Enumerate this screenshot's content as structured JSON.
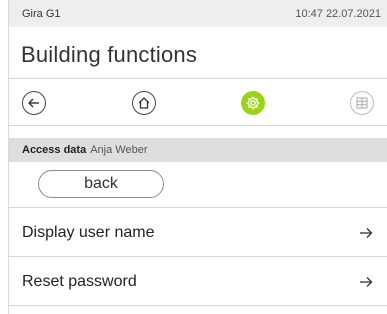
{
  "status_bar": {
    "device_name": "Gira G1",
    "datetime": "10:47 22.07.2021"
  },
  "header": {
    "title": "Building functions"
  },
  "nav": {
    "icons": [
      "back-arrow-icon",
      "home-icon",
      "settings-gear-icon",
      "grid-icon"
    ],
    "active_color": "#9bd31c"
  },
  "info_bar": {
    "label": "Access data",
    "value": "Anja Weber"
  },
  "back_button": {
    "label": "back"
  },
  "menu": {
    "items": [
      {
        "label": "Display user name",
        "icon": "arrow-right-icon"
      },
      {
        "label": "Reset password",
        "icon": "arrow-right-icon"
      }
    ]
  }
}
